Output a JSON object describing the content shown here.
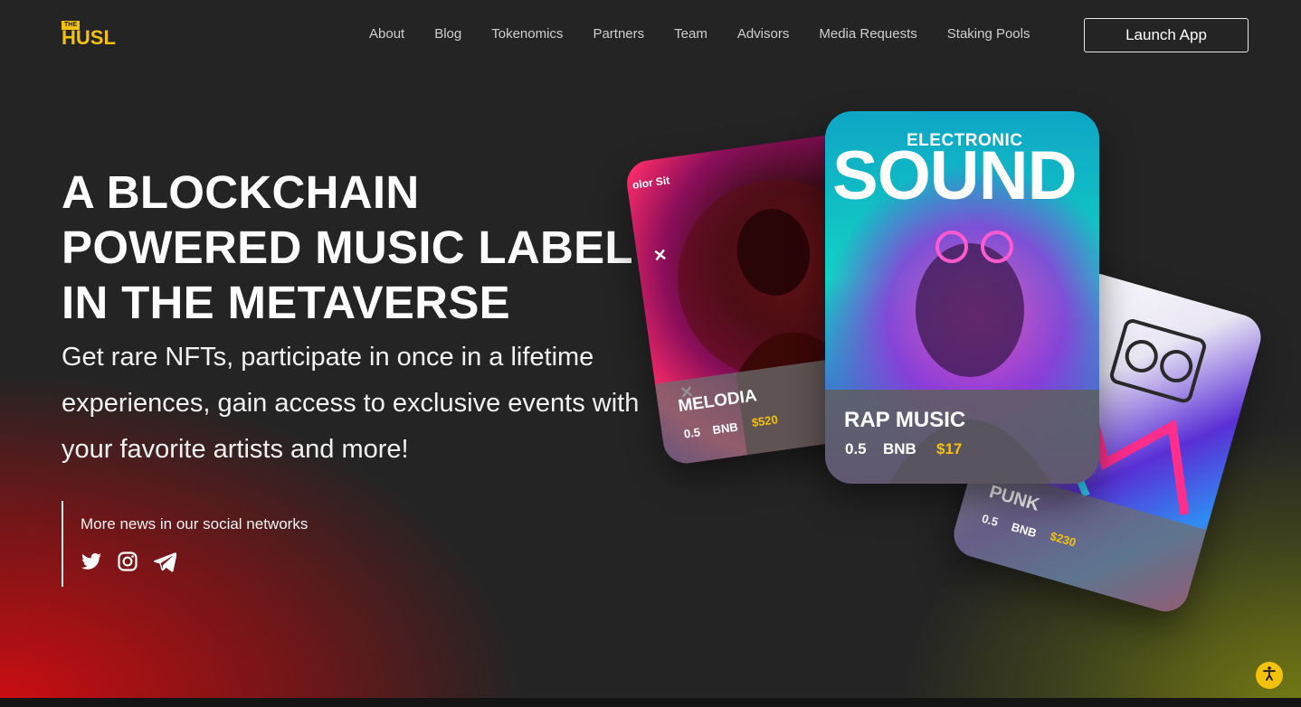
{
  "logo": {
    "top": "THE",
    "main": "HUSL"
  },
  "nav": [
    {
      "label": "About"
    },
    {
      "label": "Blog"
    },
    {
      "label": "Tokenomics"
    },
    {
      "label": "Partners"
    },
    {
      "label": "Team"
    },
    {
      "label": "Advisors"
    },
    {
      "label": "Media Requests"
    },
    {
      "label": "Staking Pools"
    }
  ],
  "launch_label": "Launch App",
  "hero": {
    "headline": "A BLOCKCHAIN POWERED MUSIC LABEL IN THE METAVERSE",
    "subhead": "Get rare NFTs, participate in once in a lifetime experiences, gain access to exclusive events with your favorite artists and more!"
  },
  "social": {
    "title": "More news in our social networks",
    "icons": [
      "twitter-icon",
      "instagram-icon",
      "telegram-icon"
    ]
  },
  "cards": {
    "melodia": {
      "title": "MELODIA",
      "amount": "0.5",
      "currency": "BNB",
      "price": "$520",
      "art_text": "olor Sit"
    },
    "rap": {
      "title": "RAP MUSIC",
      "amount": "0.5",
      "currency": "BNB",
      "price": "$17",
      "art_small": "ELECTRONIC",
      "art_big": "SOUND"
    },
    "punk": {
      "title": "PUNK",
      "amount": "0.5",
      "currency": "BNB",
      "price": "$230"
    }
  },
  "colors": {
    "accent": "#f4c20d",
    "background": "#242424",
    "red_glow": "#d60c10",
    "olive_glow": "#788012"
  }
}
